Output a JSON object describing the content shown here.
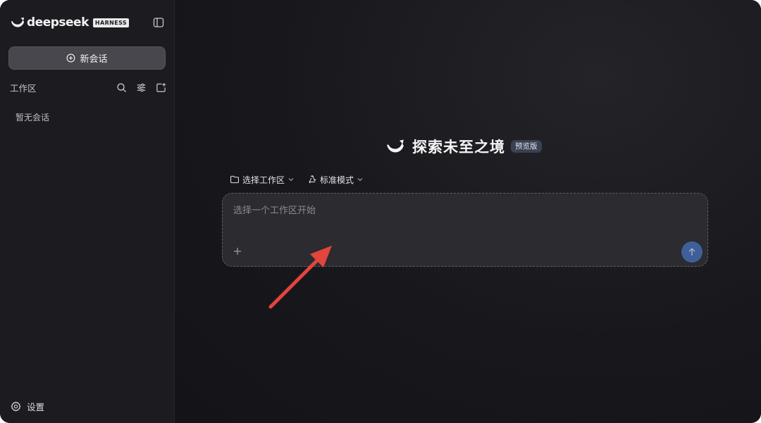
{
  "brand": {
    "name": "deepseek",
    "tag": "HARNESS"
  },
  "sidebar": {
    "new_chat_label": "新会话",
    "workspace_title": "工作区",
    "empty_text": "暂无会话",
    "settings_label": "设置",
    "icons": [
      "panel-toggle-icon",
      "search-icon",
      "filter-sliders-icon",
      "new-folder-icon",
      "gear-icon"
    ]
  },
  "main": {
    "hero_title": "探索未至之境",
    "hero_badge": "预览版",
    "workspace_selector": "选择工作区",
    "mode_selector": "标准模式",
    "input_placeholder": "选择一个工作区开始",
    "icons": [
      "folder-icon",
      "recycle-icon",
      "chevron-down-icon",
      "plus-icon",
      "send-arrow-icon"
    ]
  },
  "colors": {
    "background": "#17171b",
    "sidebar": "#1c1c20",
    "composer": "#2b2b30",
    "send_button": "#3f5f98",
    "badge": "#3b4152",
    "annotation_arrow": "#e2453c"
  }
}
